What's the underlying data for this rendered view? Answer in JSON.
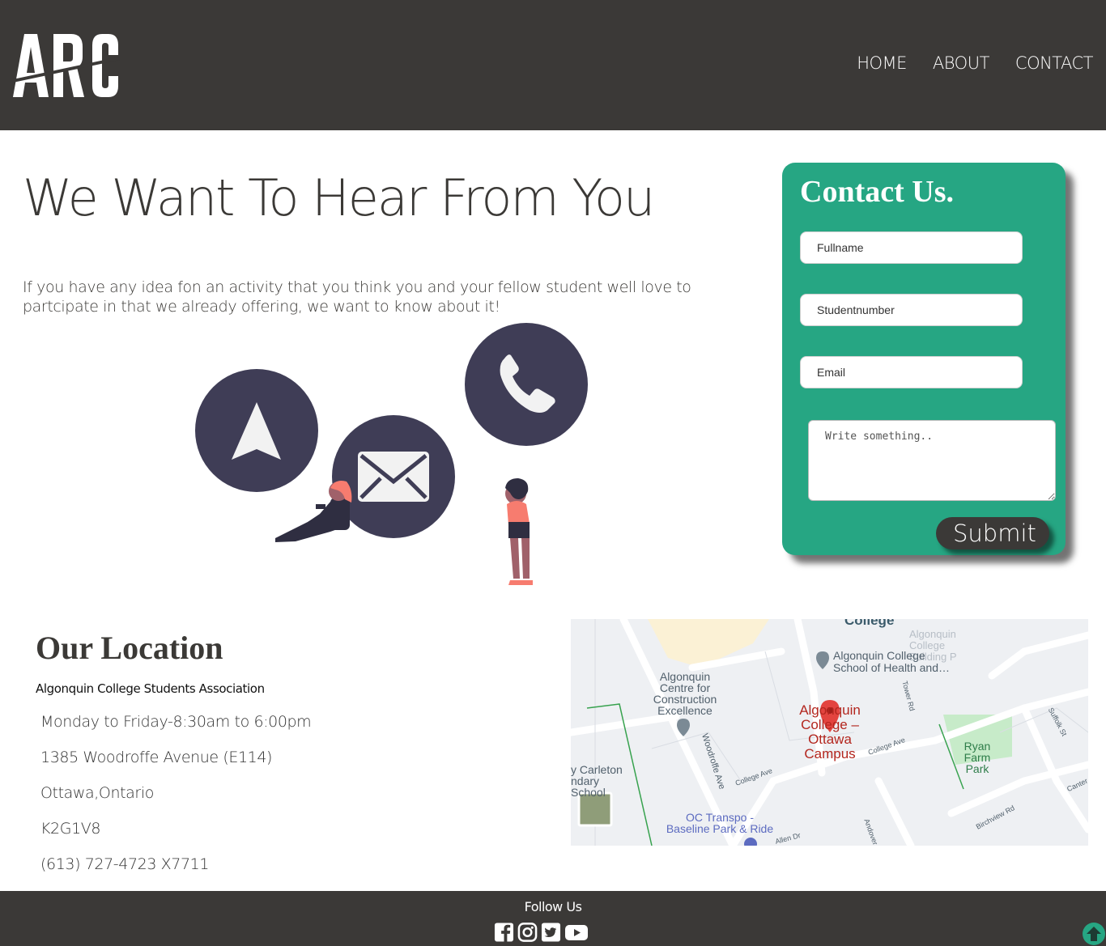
{
  "header": {
    "logo_text": "ARC",
    "nav": [
      {
        "label": "HOME"
      },
      {
        "label": "ABOUT"
      },
      {
        "label": "CONTACT"
      }
    ]
  },
  "hero": {
    "title": "We Want To Hear From You",
    "text": "If you have any idea fon an activity that you think you and your fellow student well love to partcipate in that we already offering, we want to know about it!"
  },
  "contact_form": {
    "title": "Contact Us.",
    "fullname_placeholder": "Fullname",
    "studentnumber_placeholder": "Studentnumber",
    "email_placeholder": "Email",
    "message_placeholder": "Write something..",
    "submit_label": "Submit",
    "accent_color": "#26a683"
  },
  "location": {
    "title": "Our Location",
    "association": "Algonquin College Students Association",
    "hours": "Monday to Friday-8:30am to 6:00pm",
    "address": "1385 Woodroffe Avenue (E114)",
    "city": "Ottawa,Ontario",
    "postal": "K2G1V8",
    "phone": "(613) 727-4723 X7711"
  },
  "map": {
    "labels": {
      "college_top": "College",
      "building_p": "Algonquin College Building P",
      "school_health": "Algonquin College School of Health and…",
      "construction": "Algonquin Centre for Construction Excellence",
      "campus": "Algonquin College – Ottawa Campus",
      "ryan_farm": "Ryan Farm Park",
      "carleton": "y Carleton ndary School",
      "oc_transpo": "OC Transpo - Baseline Park & Ride",
      "woodroffe": "Woodroffe Ave",
      "college_ave": "College Ave",
      "college_ave2": "College Ave",
      "tower_rd": "Tower Rd",
      "suffolk": "Suffolk St",
      "birchview": "Birchview Rd",
      "canter": "Canter",
      "andover": "Andover",
      "allen": "Allen Dr"
    }
  },
  "footer": {
    "follow_label": "Follow Us",
    "socials": [
      "facebook-icon",
      "instagram-icon",
      "twitter-icon",
      "youtube-icon"
    ]
  },
  "colors": {
    "header_bg": "#3b3937",
    "contact_card": "#26a683",
    "illustration_circle": "#3f3d56",
    "accent_pink": "#f77c6f"
  }
}
